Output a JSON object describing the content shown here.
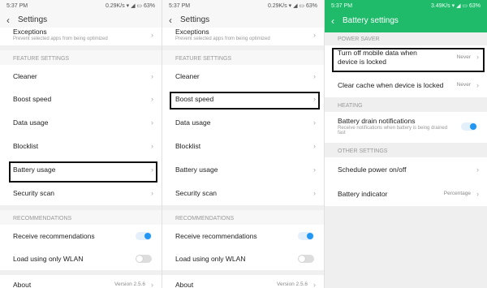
{
  "status": {
    "time": "5:37 PM",
    "left_speed": "0.29K/s",
    "mid_speed": "0.29K/s",
    "right_speed": "3.49K/s",
    "battery": "63%"
  },
  "panel1": {
    "title": "Settings",
    "exceptions": {
      "label": "Exceptions",
      "sub": "Prevent selected apps from being optimized"
    },
    "feature_settings_label": "FEATURE SETTINGS",
    "items": [
      "Cleaner",
      "Boost speed",
      "Data usage",
      "Blocklist",
      "Battery usage",
      "Security scan"
    ],
    "recommendations_label": "RECOMMENDATIONS",
    "receive": "Receive recommendations",
    "wlan": "Load using only WLAN",
    "about": "About",
    "version": "Version 2.5.6"
  },
  "panel2": {
    "title": "Settings",
    "exceptions": {
      "label": "Exceptions",
      "sub": "Prevent selected apps from being optimized"
    },
    "feature_settings_label": "FEATURE SETTINGS",
    "items": [
      "Cleaner",
      "Boost speed",
      "Data usage",
      "Blocklist",
      "Battery usage",
      "Security scan"
    ],
    "recommendations_label": "RECOMMENDATIONS",
    "receive": "Receive recommendations",
    "wlan": "Load using only WLAN",
    "about": "About",
    "version": "Version 2.5.6"
  },
  "panel3": {
    "title": "Battery settings",
    "power_saver_label": "POWER SAVER",
    "turn_off": {
      "label": "Turn off mobile data when device is locked",
      "value": "Never"
    },
    "clear_cache": {
      "label": "Clear cache when device is locked",
      "value": "Never"
    },
    "heating_label": "HEATING",
    "drain": {
      "label": "Battery drain notifications",
      "sub": "Receive notifications when battery is being drained fast"
    },
    "other_label": "OTHER SETTINGS",
    "schedule": "Schedule power on/off",
    "indicator": {
      "label": "Battery indicator",
      "value": "Percentage"
    }
  },
  "toggles": {
    "receive_recommendations": true,
    "load_wlan": false,
    "battery_drain": true
  },
  "colors": {
    "accent_green": "#1fba6a",
    "toggle_blue": "#2196f3"
  }
}
